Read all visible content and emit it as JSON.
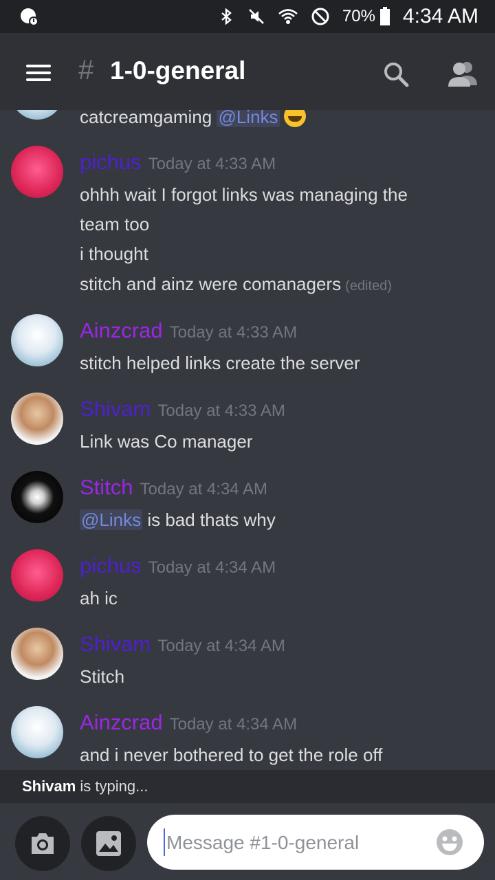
{
  "status_bar": {
    "battery": "70%",
    "time": "4:34 AM",
    "icons": [
      "notification-icon",
      "bluetooth-icon",
      "mute-icon",
      "wifi-icon",
      "do-not-disturb-icon",
      "battery-icon"
    ]
  },
  "header": {
    "hash": "#",
    "channel": "1-0-general",
    "icons": [
      "menu-icon",
      "search-icon",
      "members-icon"
    ]
  },
  "messages": [
    {
      "partial": true,
      "text": "catcreamgaming",
      "mention": "@Links"
    },
    {
      "user": "pichus",
      "time": "Today at 4:33 AM",
      "lines": [
        "ohhh wait I forgot links was managing the",
        "team too",
        "i thought",
        "stitch and ainz were comanagers"
      ],
      "edited": "(edited)"
    },
    {
      "user": "Ainzcrad",
      "time": "Today at 4:33 AM",
      "lines": [
        "stitch helped links create the server"
      ]
    },
    {
      "user": "Shivam",
      "time": "Today at 4:33 AM",
      "lines": [
        "Link was Co manager"
      ]
    },
    {
      "user": "Stitch",
      "time": "Today at 4:34 AM",
      "mention": "@Links",
      "text": "is bad thats why"
    },
    {
      "user": "pichus",
      "time": "Today at 4:34 AM",
      "lines": [
        "ah ic"
      ]
    },
    {
      "user": "Shivam",
      "time": "Today at 4:34 AM",
      "lines": [
        "Stitch"
      ]
    },
    {
      "user": "Ainzcrad",
      "time": "Today at 4:34 AM",
      "lines": [
        "and i never bothered to get the role off"
      ]
    }
  ],
  "typing": {
    "user": "Shivam",
    "text": "is typing..."
  },
  "composer": {
    "placeholder": "Message #1-0-general"
  },
  "colors": {
    "username_purple": "#9b27e6",
    "username_indigo": "#4f1fd4",
    "mention": "#7289da"
  }
}
